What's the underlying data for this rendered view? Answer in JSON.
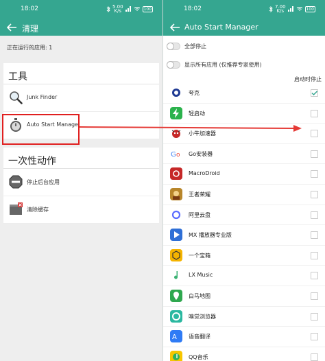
{
  "left": {
    "status": {
      "time": "18:02",
      "speed": "5.00",
      "speed_unit": "K/s",
      "battery": "100"
    },
    "title": "清理",
    "running_apps": "正在运行的应用: 1",
    "tools_section": {
      "header": "工具",
      "items": [
        {
          "label": "Junk Finder",
          "icon": "magnifier-icon"
        },
        {
          "label": "Auto Start Manage",
          "icon": "stopwatch-icon"
        }
      ]
    },
    "actions_section": {
      "header": "一次性动作",
      "items": [
        {
          "label": "停止后台应用",
          "icon": "stop-sign-icon"
        },
        {
          "label": "清除缓存",
          "icon": "clear-cache-icon"
        }
      ]
    }
  },
  "right": {
    "status": {
      "time": "18:02",
      "speed": "7.00",
      "speed_unit": "K/s",
      "battery": "100"
    },
    "title": "Auto Start Manager",
    "options": [
      {
        "label": "全部停止",
        "on": false
      },
      {
        "label": "显示所有应用 (仅推荐专家使用)",
        "on": false
      }
    ],
    "column_header": "启动时停止",
    "apps": [
      {
        "name": "夸克",
        "checked": true,
        "icon": "quark-icon"
      },
      {
        "name": "轻启动",
        "checked": false,
        "icon": "lightning-icon"
      },
      {
        "name": "小牛加速器",
        "checked": false,
        "icon": "calf-icon"
      },
      {
        "name": "Go安装器",
        "checked": false,
        "icon": "go-installer-icon"
      },
      {
        "name": "MacroDroid",
        "checked": false,
        "icon": "macrodroid-icon"
      },
      {
        "name": "王者荣耀",
        "checked": false,
        "icon": "game-hero-icon"
      },
      {
        "name": "阿里云盘",
        "checked": false,
        "icon": "cloud-drive-icon"
      },
      {
        "name": "MX 播放器专业版",
        "checked": false,
        "icon": "play-icon"
      },
      {
        "name": "一个宝箱",
        "checked": false,
        "icon": "box-icon"
      },
      {
        "name": "LX Music",
        "checked": false,
        "icon": "music-note-icon"
      },
      {
        "name": "白马地图",
        "checked": false,
        "icon": "map-pin-icon"
      },
      {
        "name": "嗅觉浏览器",
        "checked": false,
        "icon": "browser-icon"
      },
      {
        "name": "语音翻译",
        "checked": false,
        "icon": "translate-icon"
      },
      {
        "name": "QQ音乐",
        "checked": false,
        "icon": "qq-music-icon"
      }
    ]
  },
  "colors": {
    "accent": "#35a690",
    "highlight_red": "#e02020"
  }
}
